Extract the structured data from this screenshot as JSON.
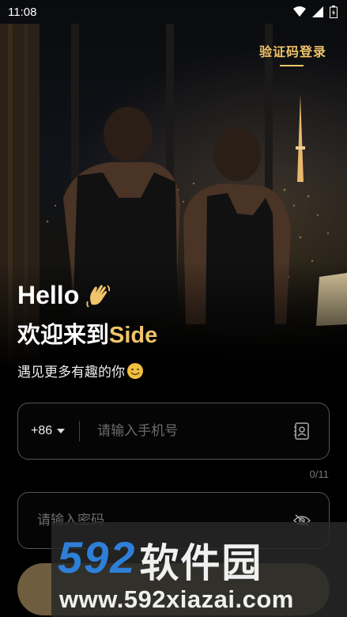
{
  "status_bar": {
    "time": "11:08"
  },
  "top_link": {
    "label": "验证码登录"
  },
  "greeting": {
    "hello": "Hello",
    "welcome_prefix": "欢迎来到",
    "brand": "Side",
    "subtitle": "遇见更多有趣的你"
  },
  "phone": {
    "country_code": "+86",
    "placeholder": "请输入手机号",
    "counter": "0/11"
  },
  "password": {
    "placeholder": "请输入密码"
  },
  "watermark": {
    "number": "592",
    "name": "软件园",
    "url": "www.592xiazai.com"
  },
  "colors": {
    "accent": "#f0c46a",
    "button": "#6e5d3f",
    "watermark_blue": "#2e7fd8"
  },
  "icons": [
    "wifi-icon",
    "signal-icon",
    "battery-icon",
    "waving-hand-icon",
    "wink-emoji-icon",
    "dropdown-arrow-icon",
    "contact-book-icon",
    "eye-off-icon"
  ]
}
